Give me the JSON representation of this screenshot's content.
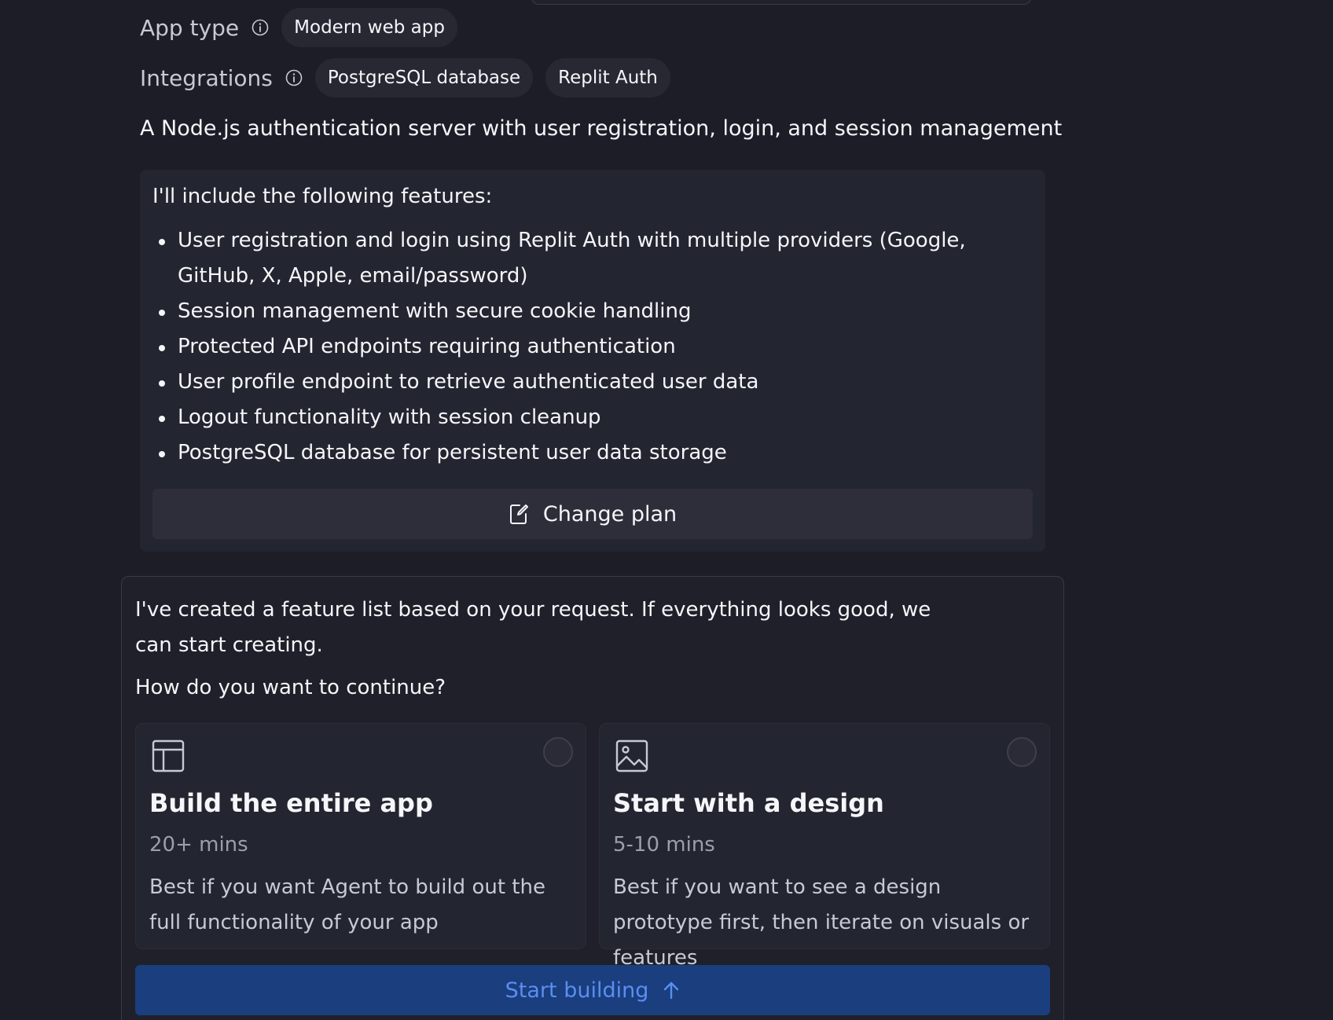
{
  "app_type": {
    "label": "App type",
    "info_icon": "info-icon",
    "value": "Modern web app"
  },
  "integrations": {
    "label": "Integrations",
    "info_icon": "info-icon",
    "items": [
      "PostgreSQL database",
      "Replit Auth"
    ]
  },
  "description": "A Node.js authentication server with user registration, login, and session management",
  "features": {
    "intro": "I'll include the following features:",
    "items": [
      "User registration and login using Replit Auth with multiple providers (Google, GitHub, X, Apple, email/password)",
      "Session management with secure cookie handling",
      "Protected API endpoints requiring authentication",
      "User profile endpoint to retrieve authenticated user data",
      "Logout functionality with session cleanup",
      "PostgreSQL database for persistent user data storage"
    ],
    "change_plan": {
      "label": "Change plan",
      "icon": "edit-icon"
    }
  },
  "continue_panel": {
    "message": "I've created a feature list based on your request. If everything looks good, we can start creating.",
    "question": "How do you want to continue?",
    "options": [
      {
        "icon": "layout-icon",
        "title": "Build the entire app",
        "time": "20+ mins",
        "description": "Best if you want Agent to build out the full functionality of your app",
        "selected": false
      },
      {
        "icon": "image-icon",
        "title": "Start with a design",
        "time": "5-10 mins",
        "description": "Best if you want to see a design prototype first, then iterate on visuals or features",
        "selected": false
      }
    ],
    "start_button": {
      "label": "Start building",
      "icon": "arrow-up-icon"
    }
  },
  "colors": {
    "background": "#1c1d27",
    "card": "#232530",
    "primary_button": "#1a3e7e",
    "primary_text": "#5b8ef0"
  }
}
